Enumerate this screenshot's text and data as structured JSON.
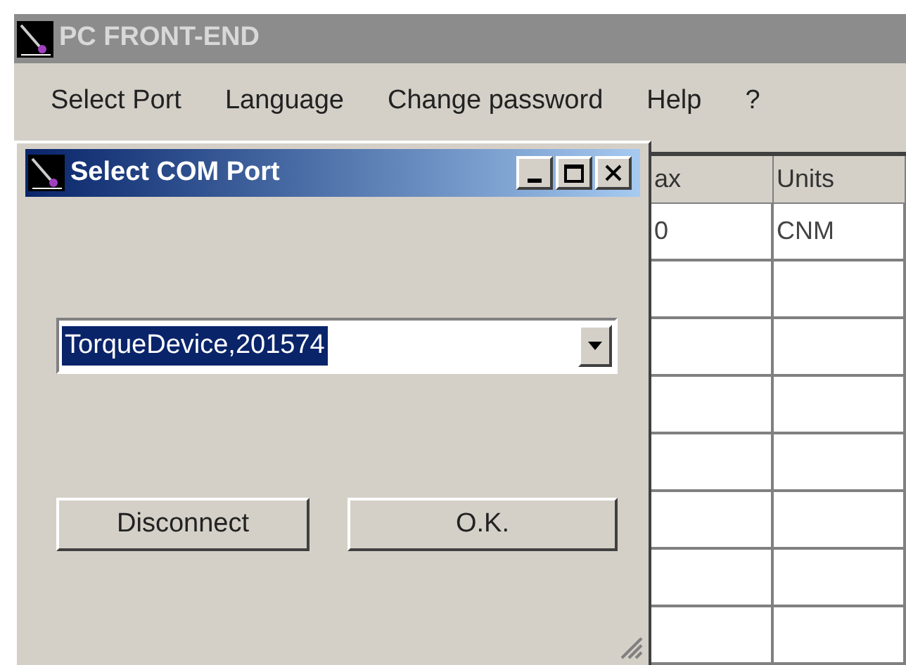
{
  "window": {
    "title": "PC FRONT-END"
  },
  "menu": [
    {
      "label": "Select Port"
    },
    {
      "label": "Language"
    },
    {
      "label": "Change password"
    },
    {
      "label": "Help"
    },
    {
      "label": "?"
    }
  ],
  "dialog": {
    "title": "Select COM Port",
    "combo": {
      "value": "TorqueDevice,201574"
    },
    "buttons": [
      {
        "label": "Disconnect"
      },
      {
        "label": "O.K."
      }
    ]
  },
  "table": {
    "columns": [
      "ax",
      "Units"
    ],
    "rows": [
      [
        "0",
        "CNM"
      ],
      [
        "",
        ""
      ],
      [
        "",
        ""
      ],
      [
        "",
        ""
      ],
      [
        "",
        ""
      ],
      [
        "",
        ""
      ],
      [
        "",
        ""
      ],
      [
        "",
        ""
      ]
    ]
  }
}
